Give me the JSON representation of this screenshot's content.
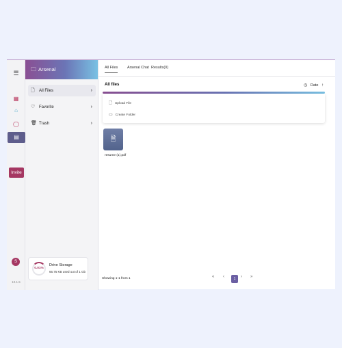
{
  "rail": {
    "menu_icon": "☰",
    "nav_icons": [
      "grid-icon",
      "home-icon",
      "chat-icon",
      "folder-icon"
    ],
    "invite_label": "Invite",
    "avatar_letter": "S",
    "version": "10.1.5"
  },
  "panel": {
    "title": "Arsenal",
    "items": [
      {
        "label": "All Files",
        "icon": "file-icon"
      },
      {
        "label": "Favorite",
        "icon": "heart-icon"
      },
      {
        "label": "Trash",
        "icon": "trash-icon"
      }
    ],
    "storage": {
      "percent_label": "0.01%",
      "title": "Drive Storage",
      "detail": "66.75 KB used out of 1 Gb"
    }
  },
  "tabs": [
    "All Files",
    "Arsenal Chat",
    "Results(0)"
  ],
  "main": {
    "section_title": "All files",
    "sort_label": "Date",
    "dropdown": [
      "Upload File",
      "Create Folder"
    ],
    "file_name": "resume (1).pdf",
    "showing": "Showing 1-1 from 1",
    "current_page": "1"
  },
  "colors": {
    "accent": "#a53762",
    "gradient_start": "#8a4f93",
    "gradient_end": "#79c1e3",
    "pager_active": "#6b5fa3"
  }
}
